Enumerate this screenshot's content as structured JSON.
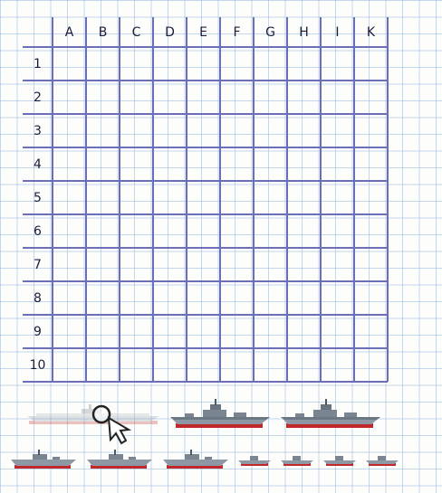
{
  "board": {
    "columns": [
      "A",
      "B",
      "C",
      "D",
      "E",
      "F",
      "G",
      "H",
      "I",
      "K"
    ],
    "rows": [
      "1",
      "2",
      "3",
      "4",
      "5",
      "6",
      "7",
      "8",
      "9",
      "10"
    ]
  },
  "fleet": [
    {
      "name": "aircraft-carrier",
      "decks": 4,
      "status": "placed"
    },
    {
      "name": "cruiser-1",
      "decks": 3,
      "status": "available"
    },
    {
      "name": "cruiser-2",
      "decks": 3,
      "status": "available"
    },
    {
      "name": "destroyer-1",
      "decks": 2,
      "status": "available"
    },
    {
      "name": "destroyer-2",
      "decks": 2,
      "status": "available"
    },
    {
      "name": "destroyer-3",
      "decks": 2,
      "status": "available"
    },
    {
      "name": "boat-1",
      "decks": 1,
      "status": "available"
    },
    {
      "name": "boat-2",
      "decks": 1,
      "status": "available"
    },
    {
      "name": "boat-3",
      "decks": 1,
      "status": "available"
    },
    {
      "name": "boat-4",
      "decks": 1,
      "status": "available"
    }
  ],
  "colors": {
    "grid_line": "#6a6fb8",
    "paper_line": "#96b9e1",
    "hull": "#8e98a4",
    "waterline": "#c0282b"
  },
  "icons": {
    "cursor": "search-cursor-icon"
  }
}
